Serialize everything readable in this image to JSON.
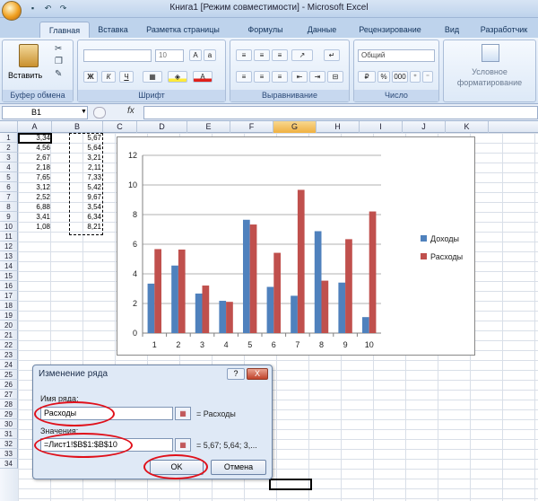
{
  "window": {
    "title": "Книга1  [Режим совместимости] - Microsoft Excel"
  },
  "qat": {
    "save_icon": "save-icon",
    "undo_icon": "undo-icon",
    "redo_icon": "redo-icon"
  },
  "tabs": [
    "Главная",
    "Вставка",
    "Разметка страницы",
    "Формулы",
    "Данные",
    "Рецензирование",
    "Вид",
    "Разработчик"
  ],
  "ribbon": {
    "paste_label": "Вставить",
    "font_size": "10",
    "number_format": "Общий",
    "groups": {
      "clipboard": "Буфер обмена",
      "font": "Шрифт",
      "alignment": "Выравнивание",
      "number": "Число"
    },
    "conditional_label": "Условное",
    "conditional_label2": "форматирование",
    "font_buttons": {
      "bold": "Ж",
      "italic": "К",
      "underline": "Ч"
    },
    "number_buttons": {
      "percent": "%",
      "thousands": "000"
    }
  },
  "formula_bar": {
    "name_box": "B1",
    "fx": "fx"
  },
  "columns": [
    "A",
    "B",
    "C",
    "D",
    "E",
    "F",
    "G",
    "H",
    "I",
    "J",
    "K"
  ],
  "rows": [
    "1",
    "2",
    "3",
    "4",
    "5",
    "6",
    "7",
    "8",
    "9",
    "10",
    "11",
    "12",
    "13",
    "14",
    "15",
    "16",
    "17",
    "18",
    "19",
    "20",
    "21",
    "22",
    "23",
    "24",
    "25",
    "26",
    "27",
    "28",
    "29",
    "30",
    "31",
    "32",
    "33",
    "34"
  ],
  "cells": {
    "A": [
      "3,34",
      "4,56",
      "2,67",
      "2,18",
      "7,65",
      "3,12",
      "2,52",
      "6,88",
      "3,41",
      "1,08"
    ],
    "B": [
      "5,67",
      "5,64",
      "3,21",
      "2,11",
      "7,33",
      "5,42",
      "9,67",
      "3,54",
      "6,34",
      "8,21"
    ]
  },
  "chart_data": {
    "type": "bar",
    "categories": [
      "1",
      "2",
      "3",
      "4",
      "5",
      "6",
      "7",
      "8",
      "9",
      "10"
    ],
    "series": [
      {
        "name": "Доходы",
        "values": [
          3.34,
          4.56,
          2.67,
          2.18,
          7.65,
          3.12,
          2.52,
          6.88,
          3.41,
          1.08
        ],
        "color": "#4f81bd"
      },
      {
        "name": "Расходы",
        "values": [
          5.67,
          5.64,
          3.21,
          2.11,
          7.33,
          5.42,
          9.67,
          3.54,
          6.34,
          8.21
        ],
        "color": "#c0504d"
      }
    ],
    "yticks": [
      "0",
      "2",
      "4",
      "6",
      "8",
      "10",
      "12"
    ],
    "ylim": [
      0,
      12
    ],
    "grid": true,
    "legend": "right"
  },
  "dialog": {
    "title": "Изменение ряда",
    "help_label": "?",
    "close_label": "X",
    "name_label": "Имя ряда:",
    "name_value": "Расходы",
    "name_result": "= Расходы",
    "values_label": "Значения:",
    "values_value": "=Лист1!$B$1:$B$10",
    "values_result": "= 5,67; 5,64; 3,...",
    "ok_label": "OK",
    "cancel_label": "Отмена"
  }
}
